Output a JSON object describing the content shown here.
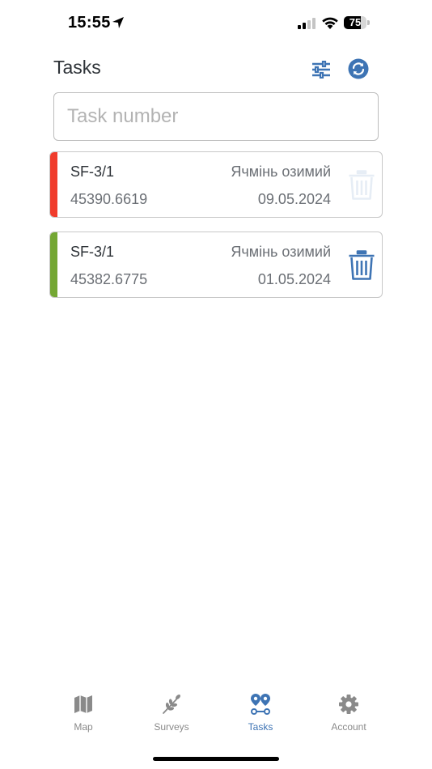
{
  "status_bar": {
    "time": "15:55",
    "battery_level": 75,
    "battery_text": "75",
    "icons": [
      "location-arrow-icon",
      "cellular-signal-icon",
      "wifi-icon",
      "battery-icon"
    ]
  },
  "header": {
    "title": "Tasks",
    "filter_icon": "sliders-icon",
    "sync_icon": "sync-icon"
  },
  "search": {
    "placeholder": "Task number",
    "value": ""
  },
  "tasks": [
    {
      "id": "SF-3/1",
      "crop": "Ячмінь озимий",
      "number": "45390.6619",
      "date": "09.05.2024",
      "status_color": "#f03c2c",
      "delete_enabled": false
    },
    {
      "id": "SF-3/1",
      "crop": "Ячмінь озимий",
      "number": "45382.6775",
      "date": "01.05.2024",
      "status_color": "#74a733",
      "delete_enabled": true
    }
  ],
  "bottom_nav": {
    "items": [
      {
        "label": "Map",
        "icon": "map-icon",
        "active": false
      },
      {
        "label": "Surveys",
        "icon": "wheat-icon",
        "active": false
      },
      {
        "label": "Tasks",
        "icon": "route-pins-icon",
        "active": true
      },
      {
        "label": "Account",
        "icon": "gear-icon",
        "active": false
      }
    ]
  },
  "colors": {
    "accent": "#3e74b4",
    "inactive": "#8a8a8a",
    "text": "#2e3338",
    "muted_text": "#6b6f75"
  }
}
